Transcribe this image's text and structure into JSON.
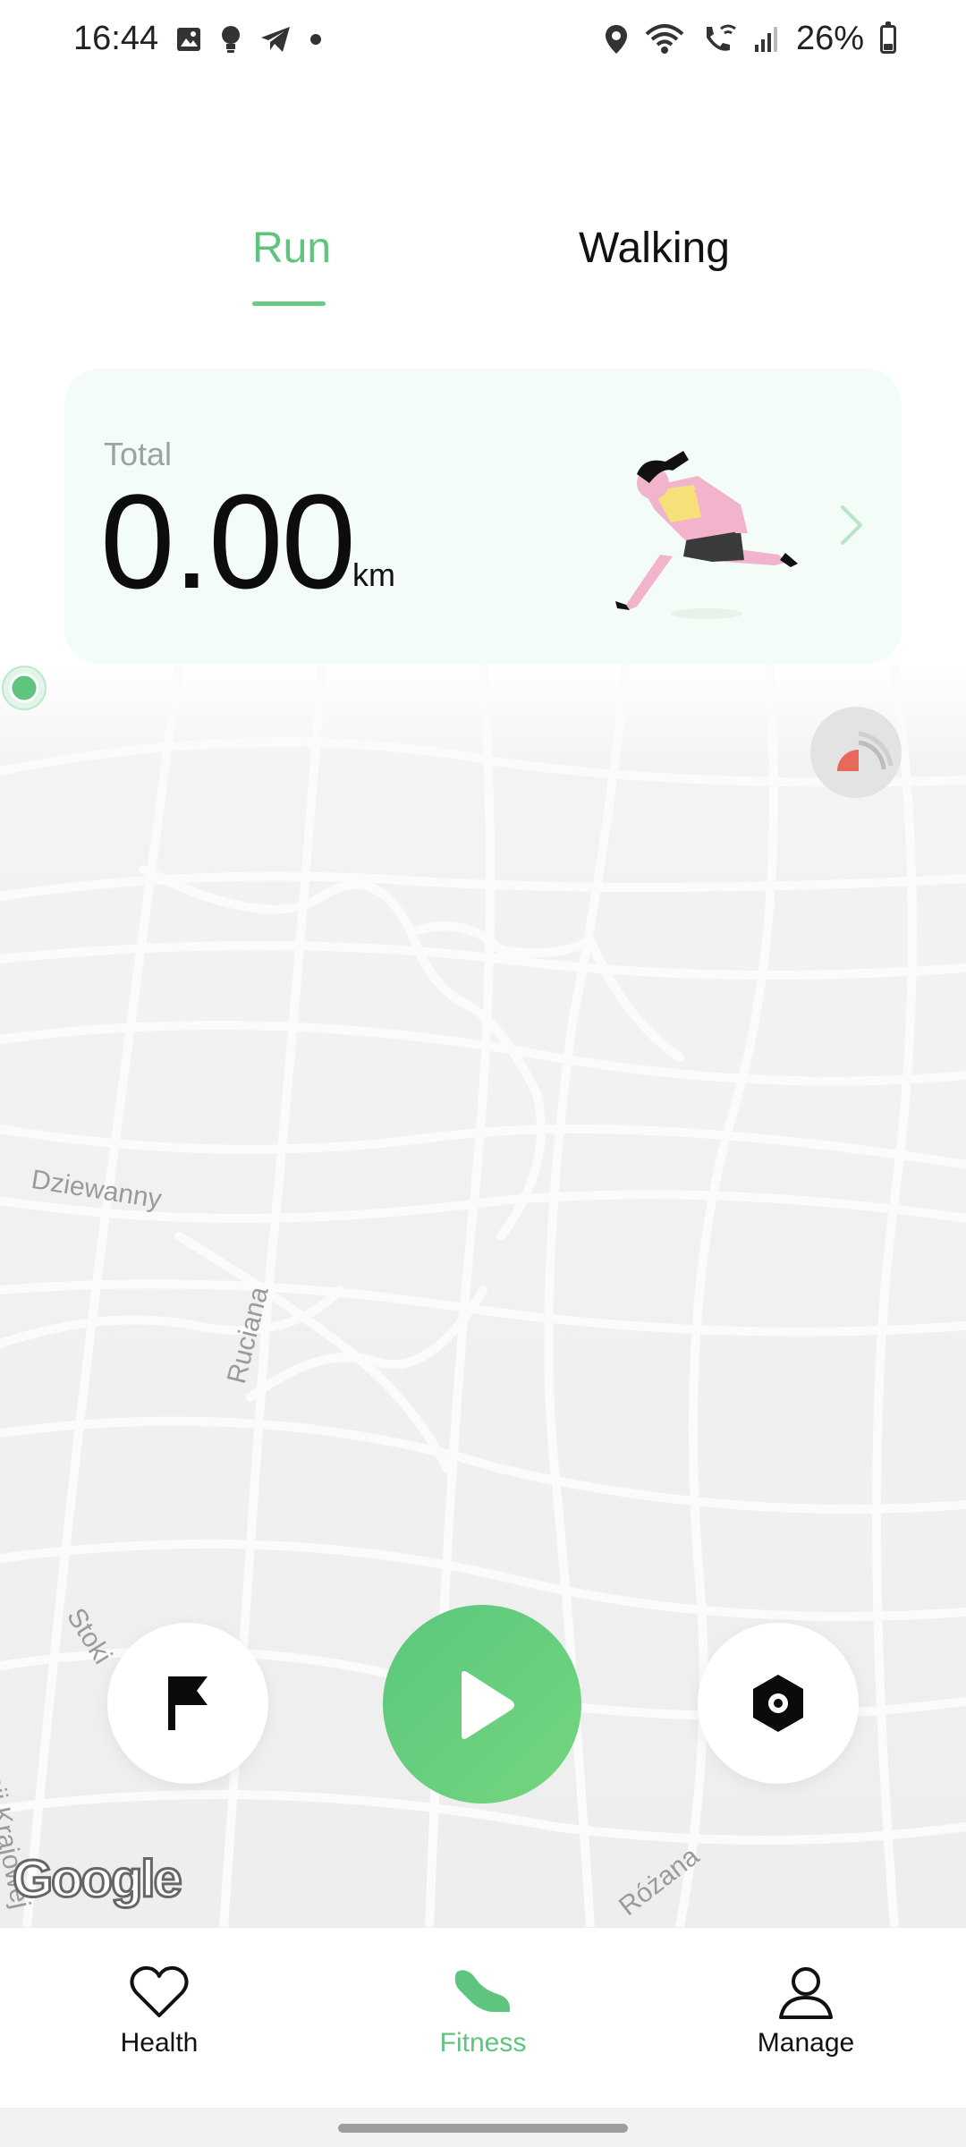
{
  "status_bar": {
    "time": "16:44",
    "battery_percent": "26%",
    "left_icons": [
      "gallery-icon",
      "bulb-icon",
      "telegram-icon",
      "dot-icon"
    ],
    "right_icons": [
      "location-icon",
      "wifi-icon",
      "wifi-calling-icon",
      "signal-icon",
      "battery-icon"
    ]
  },
  "tabs": [
    {
      "label": "Run",
      "active": true
    },
    {
      "label": "Walking",
      "active": false
    }
  ],
  "summary": {
    "label": "Total",
    "value": "0.00",
    "unit": "km"
  },
  "map": {
    "streets": [
      "Dziewanny",
      "Ruciana",
      "Stoki",
      "Armii Krajowej",
      "Różana"
    ],
    "attribution": "Google"
  },
  "controls": {
    "left": "flag-icon",
    "center": "play-icon",
    "right": "settings-icon"
  },
  "bottom_nav": [
    {
      "label": "Health",
      "icon": "heart-icon",
      "active": false
    },
    {
      "label": "Fitness",
      "icon": "shoe-icon",
      "active": true
    },
    {
      "label": "Manage",
      "icon": "person-icon",
      "active": false
    }
  ],
  "colors": {
    "accent": "#5fc47e",
    "card_bg": "#f3fcf7",
    "map_bg": "#eeeeee"
  }
}
